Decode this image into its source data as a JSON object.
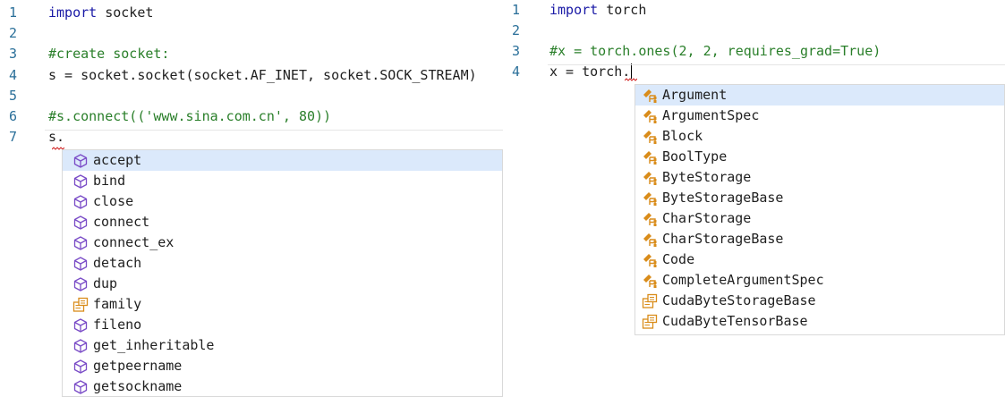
{
  "left_editor": {
    "lines": [
      {
        "num": "1",
        "parts": [
          {
            "t": "import",
            "c": "kw"
          },
          {
            "t": " socket",
            "c": ""
          }
        ]
      },
      {
        "num": "2",
        "parts": []
      },
      {
        "num": "3",
        "parts": [
          {
            "t": "#create socket:",
            "c": "cm"
          }
        ]
      },
      {
        "num": "4",
        "parts": [
          {
            "t": "s = socket.socket(socket.AF_INET, socket.SOCK_STREAM)",
            "c": ""
          }
        ]
      },
      {
        "num": "5",
        "parts": []
      },
      {
        "num": "6",
        "parts": [
          {
            "t": "#s.connect(('www.sina.com.cn', 80))",
            "c": "cm"
          }
        ]
      },
      {
        "num": "7",
        "parts": [
          {
            "t": "s.",
            "c": ""
          }
        ]
      }
    ],
    "completions": [
      {
        "label": "accept",
        "icon": "method-cube-icon",
        "selected": true
      },
      {
        "label": "bind",
        "icon": "method-cube-icon"
      },
      {
        "label": "close",
        "icon": "method-cube-icon"
      },
      {
        "label": "connect",
        "icon": "method-cube-icon"
      },
      {
        "label": "connect_ex",
        "icon": "method-cube-icon"
      },
      {
        "label": "detach",
        "icon": "method-cube-icon"
      },
      {
        "label": "dup",
        "icon": "method-cube-icon"
      },
      {
        "label": "family",
        "icon": "property-icon"
      },
      {
        "label": "fileno",
        "icon": "method-cube-icon"
      },
      {
        "label": "get_inheritable",
        "icon": "method-cube-icon"
      },
      {
        "label": "getpeername",
        "icon": "method-cube-icon"
      },
      {
        "label": "getsockname",
        "icon": "method-cube-icon"
      }
    ]
  },
  "right_editor": {
    "lines": [
      {
        "num": "1",
        "parts": [
          {
            "t": "import",
            "c": "kw"
          },
          {
            "t": " torch",
            "c": ""
          }
        ]
      },
      {
        "num": "2",
        "parts": []
      },
      {
        "num": "3",
        "parts": [
          {
            "t": "#x = torch.ones(2, 2, requires_grad=True)",
            "c": "cm"
          }
        ]
      },
      {
        "num": "4",
        "parts": [
          {
            "t": "x = torch.",
            "c": ""
          }
        ]
      }
    ],
    "completions": [
      {
        "label": "Argument",
        "icon": "class-icon",
        "selected": true
      },
      {
        "label": "ArgumentSpec",
        "icon": "class-icon"
      },
      {
        "label": "Block",
        "icon": "class-icon"
      },
      {
        "label": "BoolType",
        "icon": "class-icon"
      },
      {
        "label": "ByteStorage",
        "icon": "class-icon"
      },
      {
        "label": "ByteStorageBase",
        "icon": "class-icon"
      },
      {
        "label": "CharStorage",
        "icon": "class-icon"
      },
      {
        "label": "CharStorageBase",
        "icon": "class-icon"
      },
      {
        "label": "Code",
        "icon": "class-icon"
      },
      {
        "label": "CompleteArgumentSpec",
        "icon": "class-icon"
      },
      {
        "label": "CudaByteStorageBase",
        "icon": "property-icon"
      },
      {
        "label": "CudaByteTensorBase",
        "icon": "property-icon"
      }
    ]
  },
  "colors": {
    "line_number": "#2a6f99",
    "keyword": "#1a1aa6",
    "comment": "#2a7f2a",
    "selection": "#dbe9fb",
    "method_icon": "#7a4cc7",
    "class_icon": "#d98c1a",
    "property_icon": "#d98c1a"
  }
}
